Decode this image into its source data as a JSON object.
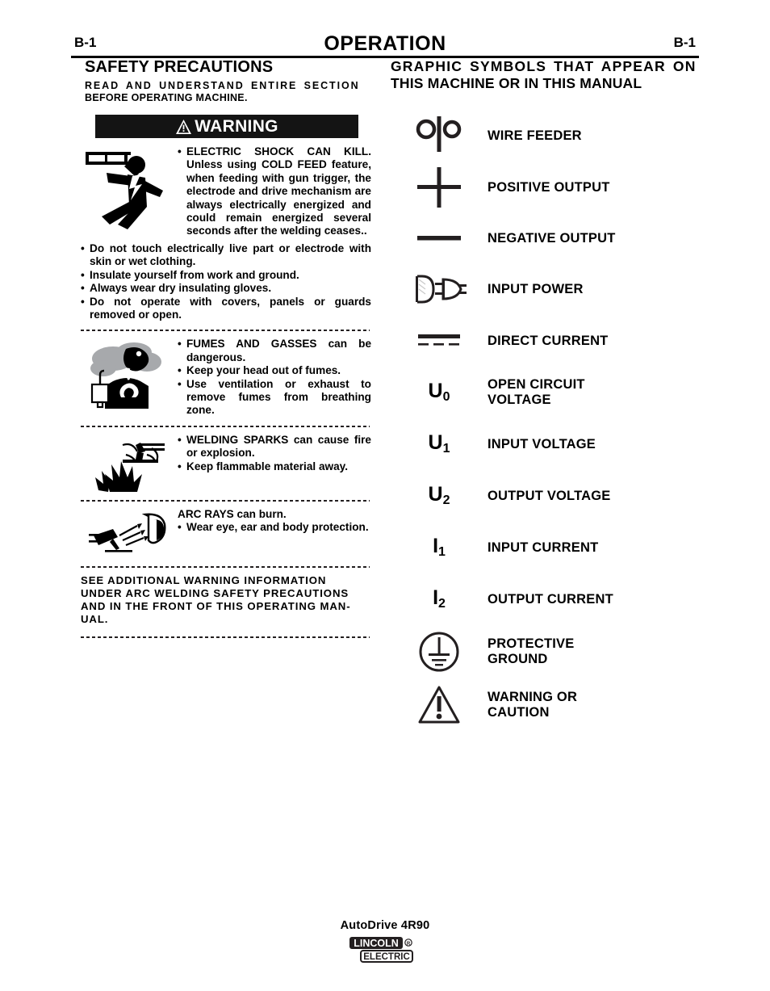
{
  "header": {
    "page_left": "B-1",
    "title": "OPERATION",
    "page_right": "B-1"
  },
  "left_column": {
    "section_title": "SAFETY PRECAUTIONS",
    "read_note_line1": "READ AND UNDERSTAND ENTIRE SECTION",
    "read_note_line2": "BEFORE OPERATING MACHINE.",
    "warning_banner": "WARNING",
    "warning_icon": "warning-triangle-icon",
    "electric_shock": {
      "icon": "electric-shock-icon",
      "bullets": [
        "ELECTRIC SHOCK CAN KILL. Unless using COLD FEED feature, when feeding with gun trigger, the electrode and drive mechanism are always electrically energized and could remain energized several seconds after the welding ceases.."
      ],
      "extra_bullets": [
        "Do not touch electrically live part or electrode with skin or wet clothing.",
        "Insulate yourself from work and ground.",
        "Always wear dry insulating gloves.",
        "Do not operate with covers, panels or guards removed or open."
      ]
    },
    "fumes": {
      "icon": "fumes-and-gasses-icon",
      "bullets": [
        "FUMES AND GASSES can be dangerous.",
        "Keep your head out of fumes.",
        "Use ventilation or exhaust to remove fumes from breathing zone."
      ]
    },
    "sparks": {
      "icon": "welding-sparks-icon",
      "bullets": [
        "WELDING SPARKS can cause fire or explosion.",
        "Keep flammable material away."
      ]
    },
    "arc_rays": {
      "icon": "arc-rays-icon",
      "heading": "ARC RAYS can burn.",
      "bullets": [
        "Wear eye, ear and body protection."
      ]
    },
    "see_additional": [
      "SEE ADDITIONAL WARNING INFORMATION",
      "UNDER ARC WELDING SAFETY PRECAUTIONS",
      "AND IN THE FRONT OF THIS OPERATING MAN-",
      "UAL."
    ]
  },
  "right_column": {
    "title_line1": "GRAPHIC SYMBOLS THAT APPEAR ON",
    "title_line2": "THIS MACHINE OR IN THIS MANUAL",
    "symbols": [
      {
        "icon": "wire-feeder-icon",
        "label": "WIRE FEEDER",
        "glyph_type": "wire-feeder"
      },
      {
        "icon": "positive-output-icon",
        "label": "POSITIVE OUTPUT",
        "glyph_type": "plus"
      },
      {
        "icon": "negative-output-icon",
        "label": "NEGATIVE OUTPUT",
        "glyph_type": "minus"
      },
      {
        "icon": "input-power-icon",
        "label": "INPUT POWER",
        "glyph_type": "plug"
      },
      {
        "icon": "direct-current-icon",
        "label": "DIRECT CURRENT",
        "glyph_type": "dc"
      },
      {
        "icon": "open-circuit-voltage-icon",
        "label": "OPEN CIRCUIT VOLTAGE",
        "glyph_type": "var",
        "var_base": "U",
        "var_sub": "0"
      },
      {
        "icon": "input-voltage-icon",
        "label": "INPUT VOLTAGE",
        "glyph_type": "var",
        "var_base": "U",
        "var_sub": "1"
      },
      {
        "icon": "output-voltage-icon",
        "label": "OUTPUT VOLTAGE",
        "glyph_type": "var",
        "var_base": "U",
        "var_sub": "2"
      },
      {
        "icon": "input-current-icon",
        "label": "INPUT CURRENT",
        "glyph_type": "var",
        "var_base": "I",
        "var_sub": "1"
      },
      {
        "icon": "output-current-icon",
        "label": "OUTPUT CURRENT",
        "glyph_type": "var",
        "var_base": "I",
        "var_sub": "2"
      },
      {
        "icon": "protective-ground-icon",
        "label": "PROTECTIVE GROUND",
        "glyph_type": "ground"
      },
      {
        "icon": "warning-caution-icon",
        "label": "WARNING OR CAUTION",
        "glyph_type": "warning-triangle"
      }
    ]
  },
  "footer": {
    "model": "AutoDrive 4R90",
    "logo_line1": "LINCOLN",
    "logo_line2": "ELECTRIC",
    "logo_mark": "®"
  },
  "colors": {
    "ink": "#000000",
    "banner_bg": "#141414",
    "dash": "#231f20",
    "smoke_gray": "#a7a9ac"
  }
}
